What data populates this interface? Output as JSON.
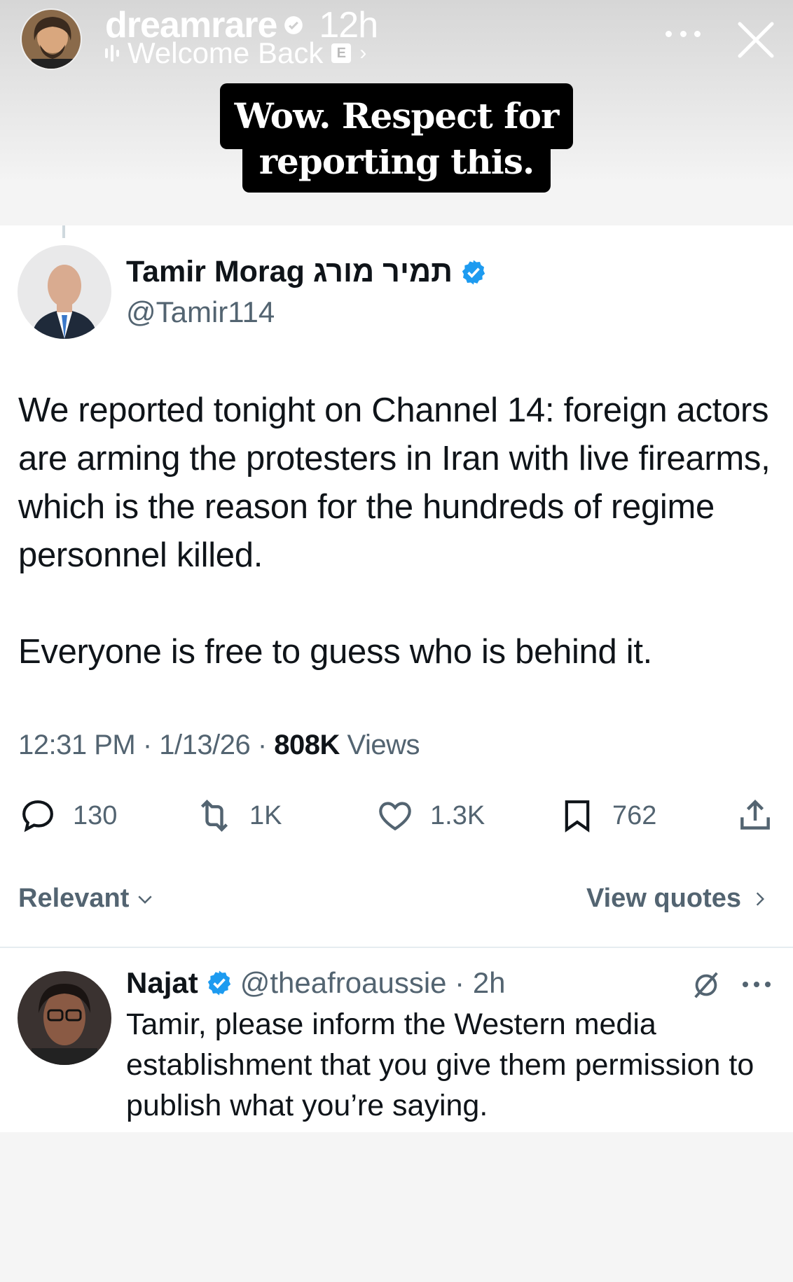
{
  "story": {
    "username": "dreamrare",
    "time": "12h",
    "music": "Welcome Back",
    "explicit": "E",
    "caption_line1": "Wow. Respect for",
    "caption_line2": "reporting this."
  },
  "tweet": {
    "author_name": "Tamir Morag תמיר מורג",
    "handle": "@Tamir114",
    "text_p1": "We reported tonight on Channel 14: foreign actors are arming the protesters in Iran with live firearms, which is the reason for the hundreds of regime personnel killed.",
    "text_p2": "Everyone is free to guess who is behind it.",
    "time": "12:31 PM · 1/13/26 · ",
    "views_count": "808K",
    "views_label": " Views",
    "replies": "130",
    "reposts": "1K",
    "likes": "1.3K",
    "bookmarks": "762"
  },
  "sort": {
    "relevant": "Relevant",
    "view_quotes": "View quotes"
  },
  "reply": {
    "name": "Najat",
    "handle": "@theafroaussie · 2h",
    "text": "Tamir, please inform the Western media establishment that you give them permission to publish what you’re saying."
  },
  "colors": {
    "verified": "#1d9bf0",
    "muted_text": "#536471",
    "text": "#0f1419"
  }
}
